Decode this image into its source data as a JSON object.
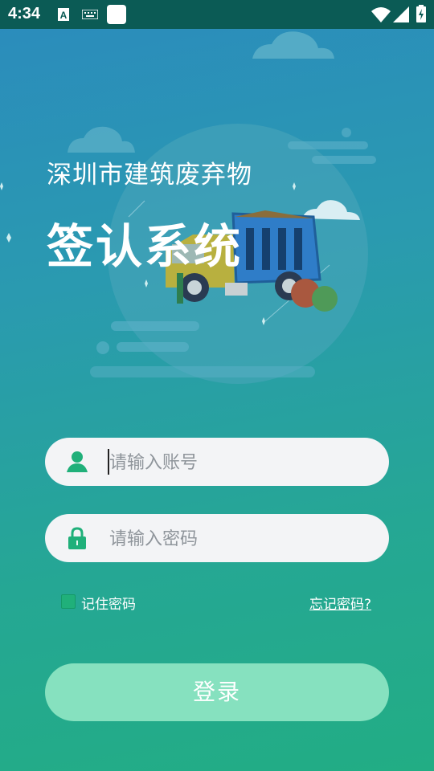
{
  "status_bar": {
    "time": "4:34",
    "icons": [
      "text-a-icon",
      "keyboard-icon",
      "blank-square-icon",
      "wifi-icon",
      "signal-icon",
      "battery-charging-icon"
    ]
  },
  "header": {
    "subtitle": "深圳市建筑废弃物",
    "title": "签认系统"
  },
  "login_form": {
    "account_placeholder": "请输入账号",
    "password_placeholder": "请输入密码",
    "remember_label": "记住密码",
    "remember_checked": true,
    "forgot_label": "忘记密码?",
    "login_label": "登录"
  },
  "colors": {
    "accent_green": "#20b07a",
    "login_button": "#86e1bf",
    "status_bar": "#0b5b55"
  }
}
